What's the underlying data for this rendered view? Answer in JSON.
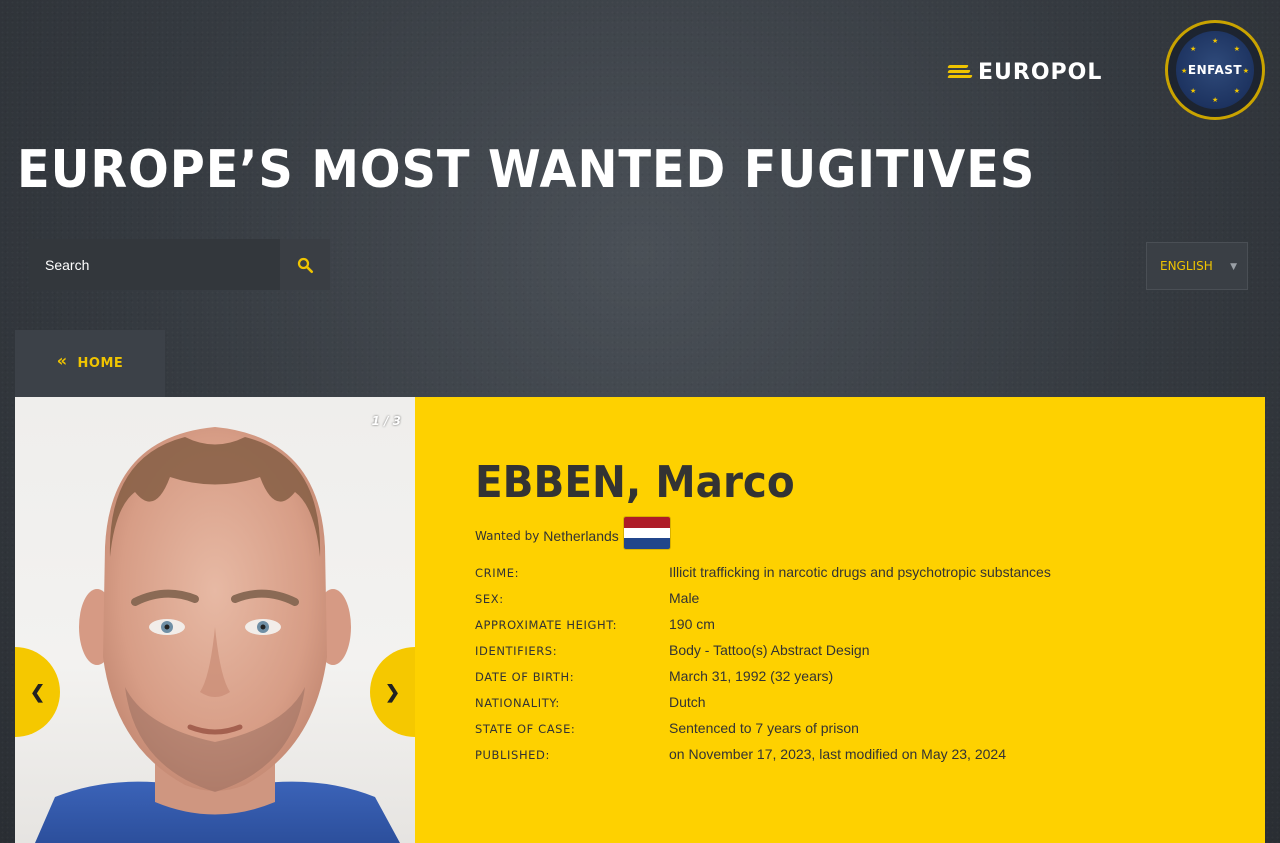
{
  "header": {
    "europol_logo_text": "EUROPOL",
    "enfast_logo_text": "ENFAST",
    "page_title": "EUROPE’S MOST WANTED FUGITIVES"
  },
  "search": {
    "placeholder": "Search",
    "icon": "search-icon"
  },
  "language": {
    "selected": "ENGLISH",
    "caret": "▼"
  },
  "nav": {
    "home_label": "HOME",
    "home_icon": "«"
  },
  "gallery": {
    "counter": "1 / 3",
    "prev": "❮",
    "next": "❯"
  },
  "fugitive": {
    "name": "EBBEN, Marco",
    "wanted_by_prefix": "Wanted by",
    "wanted_by_country": "Netherlands",
    "flag_colors": [
      "#ae1c28",
      "#ffffff",
      "#21468b"
    ],
    "details": [
      {
        "label": "CRIME:",
        "value": "Illicit trafficking in narcotic drugs and psychotropic substances"
      },
      {
        "label": "SEX:",
        "value": "Male"
      },
      {
        "label": "APPROXIMATE HEIGHT:",
        "value": "190 cm"
      },
      {
        "label": "IDENTIFIERS:",
        "value": "Body - Tattoo(s) Abstract Design"
      },
      {
        "label": "DATE OF BIRTH:",
        "value": "March 31, 1992 (32 years)"
      },
      {
        "label": "NATIONALITY:",
        "value": "Dutch"
      },
      {
        "label": "STATE OF CASE:",
        "value": "Sentenced to 7 years of prison"
      },
      {
        "label": "PUBLISHED:",
        "value": "on November 17, 2023, last modified on May 23, 2024"
      }
    ]
  },
  "colors": {
    "accent_yellow": "#fed100",
    "background": "#353a40",
    "text_dark": "#333333"
  }
}
